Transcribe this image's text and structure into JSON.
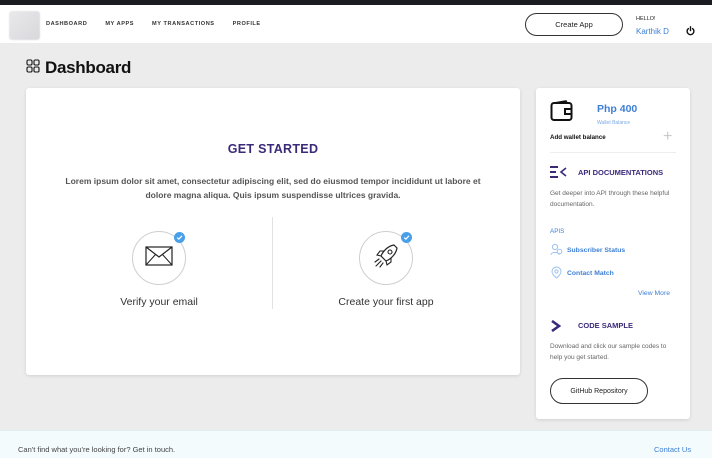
{
  "nav": {
    "links": [
      "DASHBOARD",
      "MY APPS",
      "MY TRANSACTIONS",
      "PROFILE"
    ],
    "create_app_label": "Create App",
    "greeting": "HELLO!",
    "user_name": "Karthik D"
  },
  "page": {
    "title": "Dashboard"
  },
  "get_started": {
    "title": "GET STARTED",
    "description": "Lorem ipsum dolor sit amet, consectetur adipiscing elit, sed do eiusmod tempor incididunt ut labore et dolore magna aliqua. Quis ipsum suspendisse ultrices gravida.",
    "steps": [
      {
        "label": "Verify your email",
        "icon": "envelope-icon",
        "completed": true
      },
      {
        "label": "Create your first app",
        "icon": "rocket-icon",
        "completed": true
      }
    ]
  },
  "sidebar": {
    "wallet": {
      "amount": "Php 400",
      "caption": "Wallet Balance",
      "add_label": "Add wallet balance"
    },
    "api_docs": {
      "title": "API DOCUMENTATIONS",
      "description": "Get deeper into API through these helpful documentation.",
      "apis_label": "APIS",
      "items": [
        "Subscriber Status",
        "Contact Match"
      ],
      "view_more": "View More"
    },
    "code_sample": {
      "title": "CODE SAMPLE",
      "description": "Download and click our sample codes to help you get started.",
      "button_label": "GitHub Repository"
    }
  },
  "footer": {
    "text": "Can't find what you're looking for? Get in touch.",
    "link": "Contact Us"
  },
  "colors": {
    "accent_purple": "#3b2a7a",
    "link_blue": "#3e7fd6",
    "check_blue": "#4aa0e8"
  }
}
